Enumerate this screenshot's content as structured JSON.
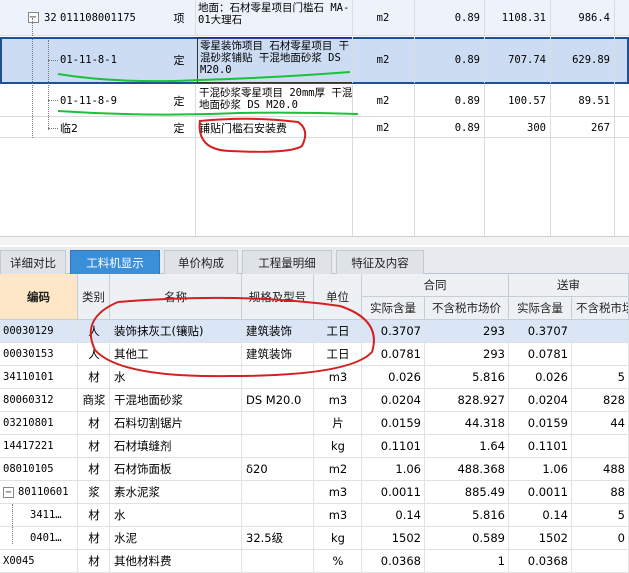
{
  "upper_rows": [
    {
      "seq": "32",
      "collapse": "−",
      "code": "011108001175",
      "type": "项",
      "name": "地面：石材零星项目门槛石 MA-01大理石",
      "unit": "m2",
      "qty": "0.89",
      "price": "1108.31",
      "total": "986.4"
    },
    {
      "code": "01-11-8-1",
      "type": "定",
      "name": "零星装饰项目 石材零星项目 干混砂浆铺贴 干混地面砂浆 DS M20.0",
      "unit": "m2",
      "qty": "0.89",
      "price": "707.74",
      "total": "629.89"
    },
    {
      "code": "01-11-8-9",
      "type": "定",
      "name": "干混砂浆零星项目 20mm厚 干混地面砂浆 DS M20.0",
      "unit": "m2",
      "qty": "0.89",
      "price": "100.57",
      "total": "89.51"
    },
    {
      "code": "临2",
      "type": "定",
      "name": "铺贴门槛石安装费",
      "unit": "m2",
      "qty": "0.89",
      "price": "300",
      "total": "267"
    }
  ],
  "tabs": [
    "详细对比",
    "工料机显示",
    "单价构成",
    "工程量明细",
    "特征及内容"
  ],
  "active_tab": "工料机显示",
  "columns": {
    "code": "编码",
    "category": "类别",
    "name": "名称",
    "spec": "规格及型号",
    "unit": "单位",
    "group_contract": "合同",
    "group_review": "送审",
    "actual_qty": "实际含量",
    "market_price": "不含税市场价",
    "actual_qty2": "实际含量",
    "market_price2": "不含税市场价"
  },
  "lower_rows": [
    {
      "code": "00030129",
      "cat": "人",
      "name": "装饰抹灰工(镶贴)",
      "spec": "建筑装饰",
      "unit": "工日",
      "qty": "0.3707",
      "price": "293",
      "qty2": "0.3707",
      "price2": ""
    },
    {
      "code": "00030153",
      "cat": "人",
      "name": "其他工",
      "spec": "建筑装饰",
      "unit": "工日",
      "qty": "0.0781",
      "price": "293",
      "qty2": "0.0781",
      "price2": ""
    },
    {
      "code": "34110101",
      "cat": "材",
      "name": "水",
      "spec": "",
      "unit": "m3",
      "qty": "0.026",
      "price": "5.816",
      "qty2": "0.026",
      "price2": "5"
    },
    {
      "code": "80060312",
      "cat": "商浆",
      "name": "干混地面砂浆",
      "spec": "DS M20.0",
      "unit": "m3",
      "qty": "0.0204",
      "price": "828.927",
      "qty2": "0.0204",
      "price2": "828"
    },
    {
      "code": "03210801",
      "cat": "材",
      "name": "石料切割锯片",
      "spec": "",
      "unit": "片",
      "qty": "0.0159",
      "price": "44.318",
      "qty2": "0.0159",
      "price2": "44"
    },
    {
      "code": "14417221",
      "cat": "材",
      "name": "石材填缝剂",
      "spec": "",
      "unit": "kg",
      "qty": "0.1101",
      "price": "1.64",
      "qty2": "0.1101",
      "price2": ""
    },
    {
      "code": "08010105",
      "cat": "材",
      "name": "石材饰面板",
      "spec": "δ20",
      "unit": "m2",
      "qty": "1.06",
      "price": "488.368",
      "qty2": "1.06",
      "price2": "488"
    },
    {
      "code": "80110601",
      "cat": "浆",
      "name": "素水泥浆",
      "spec": "",
      "unit": "m3",
      "qty": "0.0011",
      "price": "885.49",
      "qty2": "0.0011",
      "price2": "88",
      "collapse": "−"
    },
    {
      "code": "3411…",
      "cat": "材",
      "name": "水",
      "spec": "",
      "unit": "m3",
      "qty": "0.14",
      "price": "5.816",
      "qty2": "0.14",
      "price2": "5"
    },
    {
      "code": "0401…",
      "cat": "材",
      "name": "水泥",
      "spec": "32.5级",
      "unit": "kg",
      "qty": "1502",
      "price": "0.589",
      "qty2": "1502",
      "price2": "0"
    },
    {
      "code": "X0045",
      "cat": "材",
      "name": "其他材料费",
      "spec": "",
      "unit": "%",
      "qty": "0.0368",
      "price": "1",
      "qty2": "0.0368",
      "price2": ""
    }
  ],
  "colors": {
    "tab_active": "#3b8fd9",
    "selected_row": "#ccdcf3",
    "code_header": "#fde7c7",
    "green_annotation": "#19c23a",
    "red_annotation": "#d42020"
  }
}
